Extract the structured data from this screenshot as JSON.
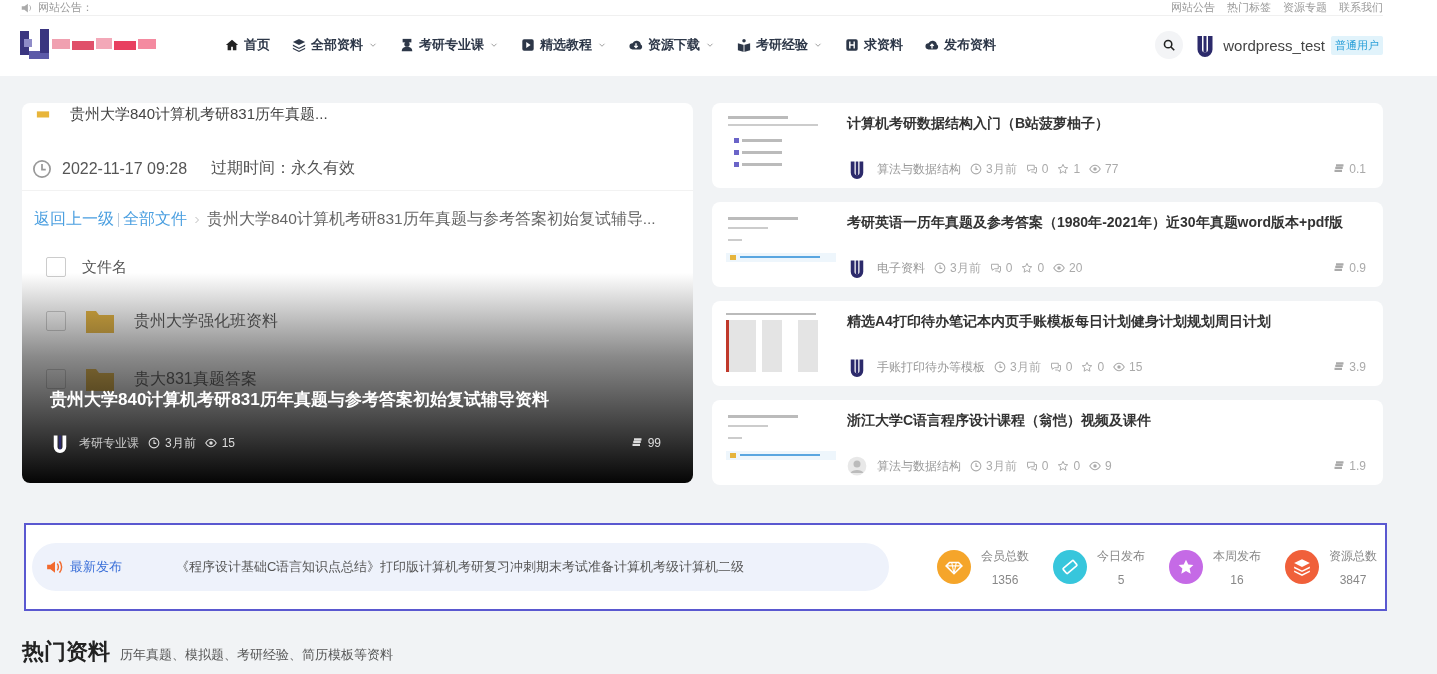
{
  "top_bar": {
    "notice_label": "网站公告：",
    "links": [
      "网站公告",
      "热门标签",
      "资源专题",
      "联系我们"
    ]
  },
  "nav": {
    "items": [
      {
        "label": "首页",
        "has_dropdown": false
      },
      {
        "label": "全部资料",
        "has_dropdown": true
      },
      {
        "label": "考研专业课",
        "has_dropdown": true
      },
      {
        "label": "精选教程",
        "has_dropdown": true
      },
      {
        "label": "资源下载",
        "has_dropdown": true
      },
      {
        "label": "考研经验",
        "has_dropdown": true
      },
      {
        "label": "求资料",
        "has_dropdown": false
      },
      {
        "label": "发布资料",
        "has_dropdown": false
      }
    ],
    "user": {
      "name": "wordpress_test",
      "badge": "普通用户"
    }
  },
  "featured": {
    "screenshot": {
      "title": "贵州大学840计算机考研831历年真题...",
      "date": "2022-11-17 09:28",
      "expiry": "过期时间：永久有效",
      "back": "返回上一级",
      "all_files": "全部文件",
      "path": "贵州大学840计算机考研831历年真题与参考答案初始复试辅导...",
      "header": {
        "label": "文件名",
        "checked": false
      },
      "rows": [
        {
          "name": "贵州大学强化班资料",
          "checked": false
        },
        {
          "name": "贵大831真题答案",
          "checked": false
        }
      ]
    },
    "title": "贵州大学840计算机考研831历年真题与参考答案初始复试辅导资料",
    "category": "考研专业课",
    "time": "3月前",
    "views": "15",
    "downloads": "99"
  },
  "posts": [
    {
      "title": "计算机考研数据结构入门（B站菠萝柚子）",
      "kind": "member",
      "category": "算法与数据结构",
      "time": "3月前",
      "comments": "0",
      "favorites": "1",
      "views": "77",
      "size": "0.1"
    },
    {
      "title": "考研英语一历年真题及参考答案（1980年-2021年）近30年真题word版本+pdf版",
      "kind": "member",
      "category": "电子资料",
      "time": "3月前",
      "comments": "0",
      "favorites": "0",
      "views": "20",
      "size": "0.9"
    },
    {
      "title": "精选A4打印待办笔记本内页手账模板每日计划健身计划规划周日计划",
      "kind": "member",
      "category": "手账打印待办等模板",
      "time": "3月前",
      "comments": "0",
      "favorites": "0",
      "views": "15",
      "size": "3.9"
    },
    {
      "title": "浙江大学C语言程序设计课程（翁恺）视频及课件",
      "kind": "guest",
      "category": "算法与数据结构",
      "time": "3月前",
      "comments": "0",
      "favorites": "0",
      "views": "9",
      "size": "1.9"
    }
  ],
  "ticker": {
    "label": "最新发布",
    "text": "《程序设计基础C语言知识点总结》打印版计算机考研复习冲刺期末考试准备计算机考级计算机二级"
  },
  "stats": [
    {
      "label": "会员总数",
      "value": "1356",
      "color": "#f5a52a"
    },
    {
      "label": "今日发布",
      "value": "5",
      "color": "#37c6dc"
    },
    {
      "label": "本周发布",
      "value": "16",
      "color": "#c56ae6"
    },
    {
      "label": "资源总数",
      "value": "3847",
      "color": "#f0603a"
    }
  ],
  "hot": {
    "title": "热门资料",
    "subtitle": "历年真题、模拟题、考研经验、简历模板等资料"
  }
}
